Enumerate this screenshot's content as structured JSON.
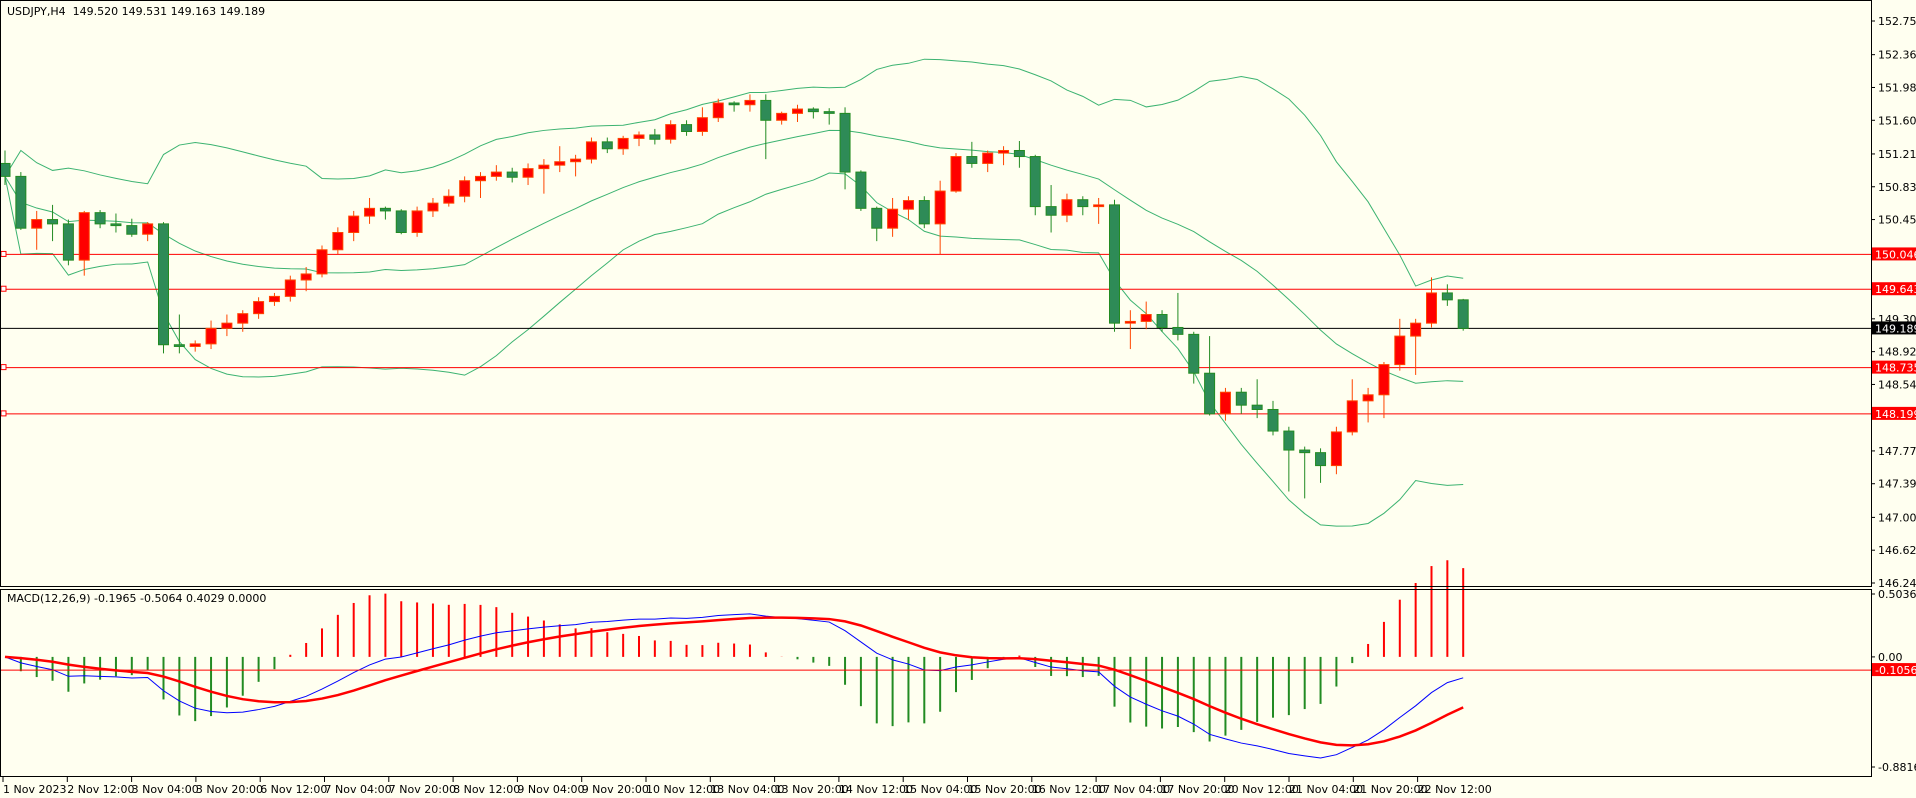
{
  "main_header": {
    "symbol": "USDJPY,H4",
    "ohlc": "149.520 149.531 149.163 149.189"
  },
  "macd_header": {
    "label": "MACD(12,26,9) -0.1965 -0.5064 0.4029 0.0000"
  },
  "colors": {
    "background": "#FFFFF0",
    "bull_fill": "#FF0000",
    "bull_border": "#FF4500",
    "bear_fill": "#2E8B57",
    "bear_border": "#228B22",
    "bands": "#3CB371",
    "level_line": "#FF0000",
    "bid_line": "#000000",
    "macd_blue": "#0000FF",
    "macd_red": "#FF0000"
  },
  "chart_data": {
    "type": "candlestick",
    "price_axis": {
      "range": [
        146.24,
        152.75
      ],
      "ticks": [
        "152.750",
        "152.360",
        "151.980",
        "151.600",
        "151.210",
        "150.830",
        "150.450",
        "149.300",
        "148.920",
        "148.540",
        "147.770",
        "147.390",
        "147.000",
        "146.620",
        "146.240"
      ]
    },
    "levels": [
      {
        "value": 150.046,
        "label": "150.046"
      },
      {
        "value": 149.643,
        "label": "149.643"
      },
      {
        "value": 148.735,
        "label": "148.735"
      },
      {
        "value": 148.199,
        "label": "148.199"
      }
    ],
    "bid": {
      "value": 149.189,
      "label": "149.189"
    },
    "time_labels": [
      "1 Nov 2023",
      "2 Nov 12:00",
      "3 Nov 04:00",
      "3 Nov 20:00",
      "6 Nov 12:00",
      "7 Nov 04:00",
      "7 Nov 20:00",
      "8 Nov 12:00",
      "9 Nov 04:00",
      "9 Nov 20:00",
      "10 Nov 12:00",
      "13 Nov 04:00",
      "13 Nov 20:00",
      "14 Nov 12:00",
      "15 Nov 04:00",
      "15 Nov 20:00",
      "16 Nov 12:00",
      "17 Nov 04:00",
      "17 Nov 20:00",
      "20 Nov 12:00",
      "21 Nov 04:00",
      "21 Nov 20:00",
      "22 Nov 12:00"
    ],
    "ohlc": [
      [
        151.1,
        151.25,
        150.85,
        150.95
      ],
      [
        150.95,
        151.0,
        150.33,
        150.35
      ],
      [
        150.35,
        150.55,
        150.1,
        150.45
      ],
      [
        150.45,
        150.62,
        150.2,
        150.4
      ],
      [
        150.4,
        150.45,
        149.92,
        149.98
      ],
      [
        149.98,
        150.55,
        149.8,
        150.53
      ],
      [
        150.53,
        150.56,
        150.35,
        150.4
      ],
      [
        150.4,
        150.52,
        150.3,
        150.38
      ],
      [
        150.38,
        150.46,
        150.25,
        150.28
      ],
      [
        150.28,
        150.42,
        150.2,
        150.4
      ],
      [
        150.4,
        150.42,
        148.9,
        149.0
      ],
      [
        149.0,
        149.35,
        148.9,
        148.98
      ],
      [
        148.98,
        149.05,
        148.92,
        149.01
      ],
      [
        149.01,
        149.28,
        148.95,
        149.19
      ],
      [
        149.19,
        149.35,
        149.1,
        149.25
      ],
      [
        149.25,
        149.4,
        149.15,
        149.36
      ],
      [
        149.36,
        149.55,
        149.3,
        149.5
      ],
      [
        149.5,
        149.6,
        149.45,
        149.56
      ],
      [
        149.56,
        149.8,
        149.5,
        149.75
      ],
      [
        149.75,
        149.9,
        149.62,
        149.82
      ],
      [
        149.82,
        150.15,
        149.78,
        150.1
      ],
      [
        150.1,
        150.36,
        150.05,
        150.3
      ],
      [
        150.3,
        150.55,
        150.2,
        150.49
      ],
      [
        150.49,
        150.7,
        150.4,
        150.58
      ],
      [
        150.58,
        150.6,
        150.45,
        150.55
      ],
      [
        150.55,
        150.57,
        150.28,
        150.3
      ],
      [
        150.3,
        150.6,
        150.25,
        150.55
      ],
      [
        150.55,
        150.7,
        150.48,
        150.64
      ],
      [
        150.64,
        150.8,
        150.6,
        150.72
      ],
      [
        150.72,
        150.95,
        150.65,
        150.9
      ],
      [
        150.9,
        151.0,
        150.7,
        150.95
      ],
      [
        150.95,
        151.08,
        150.9,
        151.0
      ],
      [
        151.0,
        151.05,
        150.88,
        150.94
      ],
      [
        150.94,
        151.1,
        150.85,
        151.04
      ],
      [
        151.04,
        151.15,
        150.75,
        151.08
      ],
      [
        151.08,
        151.3,
        151.0,
        151.12
      ],
      [
        151.12,
        151.2,
        150.95,
        151.15
      ],
      [
        151.15,
        151.4,
        151.1,
        151.35
      ],
      [
        151.35,
        151.4,
        151.22,
        151.27
      ],
      [
        151.27,
        151.42,
        151.2,
        151.39
      ],
      [
        151.39,
        151.47,
        151.3,
        151.43
      ],
      [
        151.43,
        151.5,
        151.32,
        151.38
      ],
      [
        151.38,
        151.6,
        151.33,
        151.55
      ],
      [
        151.55,
        151.6,
        151.42,
        151.47
      ],
      [
        151.47,
        151.75,
        151.42,
        151.63
      ],
      [
        151.63,
        151.85,
        151.58,
        151.8
      ],
      [
        151.8,
        151.82,
        151.7,
        151.78
      ],
      [
        151.78,
        151.9,
        151.7,
        151.83
      ],
      [
        151.83,
        151.9,
        151.15,
        151.6
      ],
      [
        151.6,
        151.7,
        151.55,
        151.68
      ],
      [
        151.68,
        151.78,
        151.58,
        151.73
      ],
      [
        151.73,
        151.75,
        151.62,
        151.7
      ],
      [
        151.7,
        151.74,
        151.55,
        151.68
      ],
      [
        151.68,
        151.75,
        150.8,
        151.0
      ],
      [
        151.0,
        151.02,
        150.55,
        150.58
      ],
      [
        150.58,
        150.6,
        150.2,
        150.35
      ],
      [
        150.35,
        150.7,
        150.25,
        150.57
      ],
      [
        150.57,
        150.72,
        150.45,
        150.67
      ],
      [
        150.67,
        150.72,
        150.35,
        150.4
      ],
      [
        150.4,
        150.9,
        150.05,
        150.78
      ],
      [
        150.78,
        151.22,
        150.76,
        151.18
      ],
      [
        151.18,
        151.35,
        151.05,
        151.1
      ],
      [
        151.1,
        151.25,
        151.0,
        151.22
      ],
      [
        151.22,
        151.3,
        151.08,
        151.25
      ],
      [
        151.25,
        151.36,
        151.05,
        151.18
      ],
      [
        151.18,
        151.2,
        150.5,
        150.6
      ],
      [
        150.6,
        150.85,
        150.3,
        150.5
      ],
      [
        150.5,
        150.75,
        150.42,
        150.68
      ],
      [
        150.68,
        150.72,
        150.5,
        150.6
      ],
      [
        150.6,
        150.7,
        150.4,
        150.62
      ],
      [
        150.62,
        150.68,
        149.15,
        149.25
      ],
      [
        149.25,
        149.4,
        148.95,
        149.27
      ],
      [
        149.27,
        149.5,
        149.18,
        149.35
      ],
      [
        149.35,
        149.4,
        149.15,
        149.2
      ],
      [
        149.2,
        149.6,
        149.05,
        149.12
      ],
      [
        149.12,
        149.15,
        148.55,
        148.67
      ],
      [
        148.67,
        149.1,
        148.18,
        148.2
      ],
      [
        148.2,
        148.5,
        148.12,
        148.45
      ],
      [
        148.45,
        148.5,
        148.2,
        148.3
      ],
      [
        148.3,
        148.6,
        148.15,
        148.25
      ],
      [
        148.25,
        148.35,
        147.95,
        148.0
      ],
      [
        148.0,
        148.05,
        147.3,
        147.78
      ],
      [
        147.78,
        147.82,
        147.22,
        147.75
      ],
      [
        147.75,
        147.8,
        147.4,
        147.6
      ],
      [
        147.6,
        148.05,
        147.5,
        147.99
      ],
      [
        147.99,
        148.6,
        147.95,
        148.35
      ],
      [
        148.35,
        148.5,
        148.1,
        148.42
      ],
      [
        148.42,
        148.8,
        148.15,
        148.77
      ],
      [
        148.77,
        149.3,
        148.7,
        149.1
      ],
      [
        149.1,
        149.3,
        148.65,
        149.25
      ],
      [
        149.25,
        149.78,
        149.2,
        149.6
      ],
      [
        149.6,
        149.7,
        149.45,
        149.52
      ],
      [
        149.52,
        149.531,
        149.163,
        149.189
      ]
    ],
    "bollinger": {
      "period": 20,
      "deviation": 2
    },
    "macd": {
      "fast": 12,
      "slow": 26,
      "signal": 9,
      "axis_range": [
        -0.8816,
        0.5036
      ],
      "ticks": [
        "0.5036",
        "0.00",
        "-0.8816"
      ],
      "current": {
        "value": -0.1056,
        "label": "-0.1056"
      }
    }
  }
}
